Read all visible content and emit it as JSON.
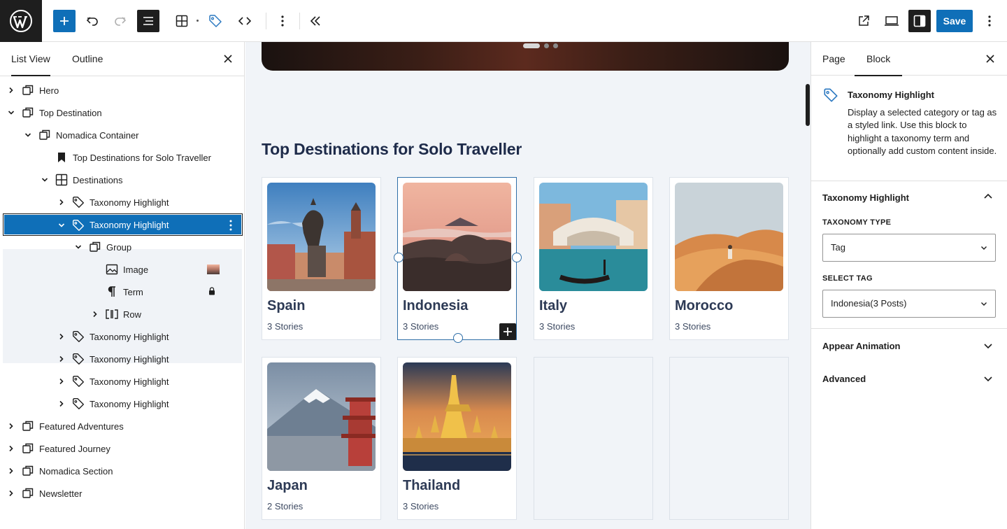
{
  "toolbar": {
    "save_label": "Save",
    "icons": [
      "wordpress-logo",
      "add-block",
      "undo",
      "redo",
      "document-overview",
      "block-grid",
      "taxonomy-tag",
      "code-nav",
      "more-options",
      "collapse",
      "view-external",
      "preview-desktop",
      "settings-sidebar",
      "more-menu"
    ]
  },
  "left_panel": {
    "tabs": [
      {
        "label": "List View",
        "active": true
      },
      {
        "label": "Outline",
        "active": false
      }
    ],
    "tree": [
      {
        "label": "Hero",
        "level": 0,
        "icon": "group",
        "expanded": false
      },
      {
        "label": "Top Destination",
        "level": 0,
        "icon": "group",
        "expanded": true
      },
      {
        "label": "Nomadica Container",
        "level": 1,
        "icon": "group",
        "expanded": true
      },
      {
        "label": "Top Destinations for Solo Traveller",
        "level": 2,
        "icon": "bookmark"
      },
      {
        "label": "Destinations",
        "level": 2,
        "icon": "grid",
        "expanded": true
      },
      {
        "label": "Taxonomy Highlight",
        "level": 3,
        "icon": "tag",
        "expanded": false
      },
      {
        "label": "Taxonomy Highlight",
        "level": 3,
        "icon": "tag",
        "expanded": true,
        "selected": true
      },
      {
        "label": "Group",
        "level": 4,
        "icon": "group",
        "expanded": true
      },
      {
        "label": "Image",
        "level": 5,
        "icon": "image"
      },
      {
        "label": "Term",
        "level": 5,
        "icon": "paragraph",
        "locked": true
      },
      {
        "label": "Row",
        "level": 5,
        "icon": "row",
        "expanded": false
      },
      {
        "label": "Taxonomy Highlight",
        "level": 3,
        "icon": "tag",
        "expanded": false
      },
      {
        "label": "Taxonomy Highlight",
        "level": 3,
        "icon": "tag",
        "expanded": false
      },
      {
        "label": "Taxonomy Highlight",
        "level": 3,
        "icon": "tag",
        "expanded": false
      },
      {
        "label": "Taxonomy Highlight",
        "level": 3,
        "icon": "tag",
        "expanded": false
      },
      {
        "label": "Featured Adventures",
        "level": 0,
        "icon": "group",
        "expanded": false
      },
      {
        "label": "Featured Journey",
        "level": 0,
        "icon": "group",
        "expanded": false
      },
      {
        "label": "Nomadica Section",
        "level": 0,
        "icon": "group",
        "expanded": false
      },
      {
        "label": "Newsletter",
        "level": 0,
        "icon": "group",
        "expanded": false
      }
    ]
  },
  "canvas": {
    "section_title": "Top Destinations for Solo Traveller",
    "cards": [
      {
        "name": "Spain",
        "stories": "3 Stories",
        "selected": false
      },
      {
        "name": "Indonesia",
        "stories": "3 Stories",
        "selected": true
      },
      {
        "name": "Italy",
        "stories": "3 Stories",
        "selected": false
      },
      {
        "name": "Morocco",
        "stories": "3 Stories",
        "selected": false
      },
      {
        "name": "Japan",
        "stories": "2 Stories",
        "selected": false
      },
      {
        "name": "Thailand",
        "stories": "3 Stories",
        "selected": false
      }
    ],
    "empty_slots": 2
  },
  "right_panel": {
    "tabs": [
      {
        "label": "Page",
        "active": false
      },
      {
        "label": "Block",
        "active": true
      }
    ],
    "block_title": "Taxonomy Highlight",
    "block_description": "Display a selected category or tag as a styled link. Use this block to highlight a taxonomy term and optionally add custom content inside.",
    "panels": {
      "main": {
        "title": "Taxonomy Highlight",
        "taxonomy_type_label": "TAXONOMY TYPE",
        "taxonomy_type_value": "Tag",
        "select_tag_label": "SELECT TAG",
        "select_tag_value": "Indonesia(3 Posts)"
      },
      "animation": {
        "title": "Appear Animation"
      },
      "advanced": {
        "title": "Advanced"
      }
    }
  },
  "colors": {
    "accent": "#0f6fb8",
    "dark": "#1e1e1e",
    "canvas_bg": "#f1f4f8",
    "heading": "#1e2b4a"
  }
}
